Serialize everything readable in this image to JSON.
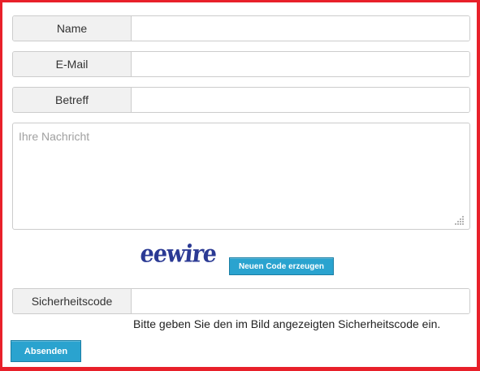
{
  "form": {
    "name": {
      "label": "Name",
      "value": ""
    },
    "email": {
      "label": "E-Mail",
      "value": ""
    },
    "subject": {
      "label": "Betreff",
      "value": ""
    },
    "message": {
      "placeholder": "Ihre Nachricht",
      "value": ""
    },
    "captcha": {
      "image_text": "eewire",
      "refresh_label": "Neuen Code erzeugen",
      "label": "Sicherheitscode",
      "value": "",
      "hint": "Bitte geben Sie den im Bild angezeigten Sicherheitscode ein."
    },
    "submit_label": "Absenden"
  },
  "colors": {
    "frame_border": "#e8202a",
    "button_bg": "#2aa3cf",
    "label_bg": "#f1f1f1",
    "captcha_ink": "#2b3a94"
  },
  "icons": {
    "resize_grip": "resize-grip-icon"
  }
}
